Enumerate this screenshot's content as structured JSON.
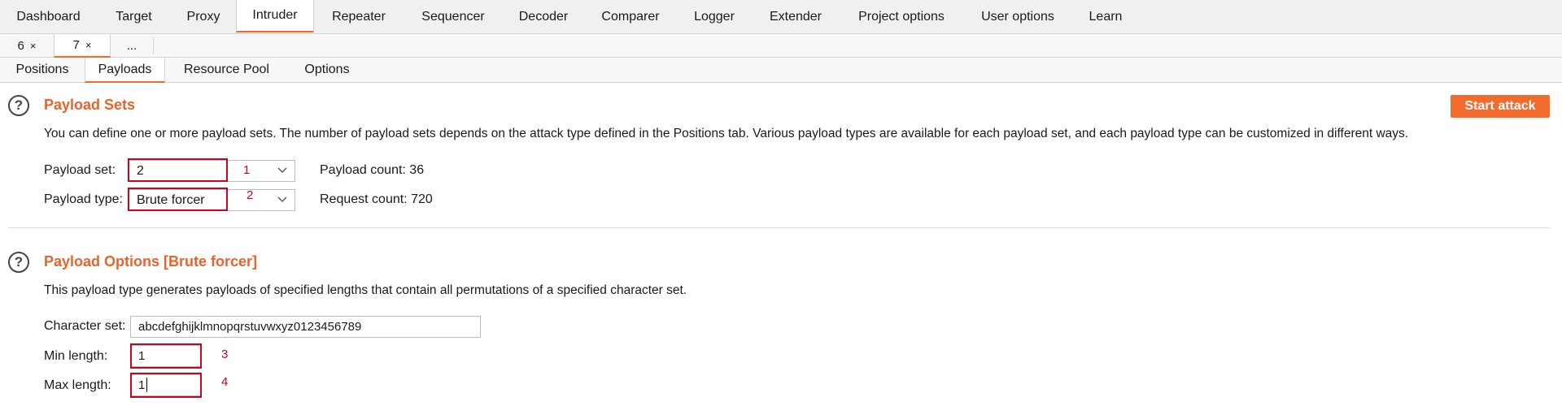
{
  "main_tabs": [
    "Dashboard",
    "Target",
    "Proxy",
    "Intruder",
    "Repeater",
    "Sequencer",
    "Decoder",
    "Comparer",
    "Logger",
    "Extender",
    "Project options",
    "User options",
    "Learn"
  ],
  "sub_tabs": [
    {
      "label": "6",
      "close": "×"
    },
    {
      "label": "7",
      "close": "×"
    },
    {
      "label": "..."
    }
  ],
  "page_tabs": [
    "Positions",
    "Payloads",
    "Resource Pool",
    "Options"
  ],
  "help_glyph": "?",
  "payload_sets": {
    "title": "Payload Sets",
    "start_attack": "Start attack",
    "description": "You can define one or more payload sets. The number of payload sets depends on the attack type defined in the Positions tab. Various payload types are available for each payload set, and each payload type can be customized in different ways.",
    "set_label": "Payload set:",
    "set_value": "2",
    "type_label": "Payload type:",
    "type_value": "Brute forcer",
    "count_label": "Payload count: 36",
    "request_label": "Request count: 720"
  },
  "payload_options": {
    "title": "Payload Options [Brute forcer]",
    "description": "This payload type generates payloads of specified lengths that contain all permutations of a specified character set.",
    "charset_label": "Character set:",
    "charset_value": "abcdefghijklmnopqrstuvwxyz0123456789",
    "min_label": "Min length:",
    "min_value": "1",
    "max_label": "Max length:",
    "max_value": "1"
  },
  "annotations": [
    "1",
    "2",
    "3",
    "4"
  ],
  "colors": {
    "accent": "#f26b2d",
    "title": "#e8632c",
    "annotation_red": "#d0021b"
  }
}
